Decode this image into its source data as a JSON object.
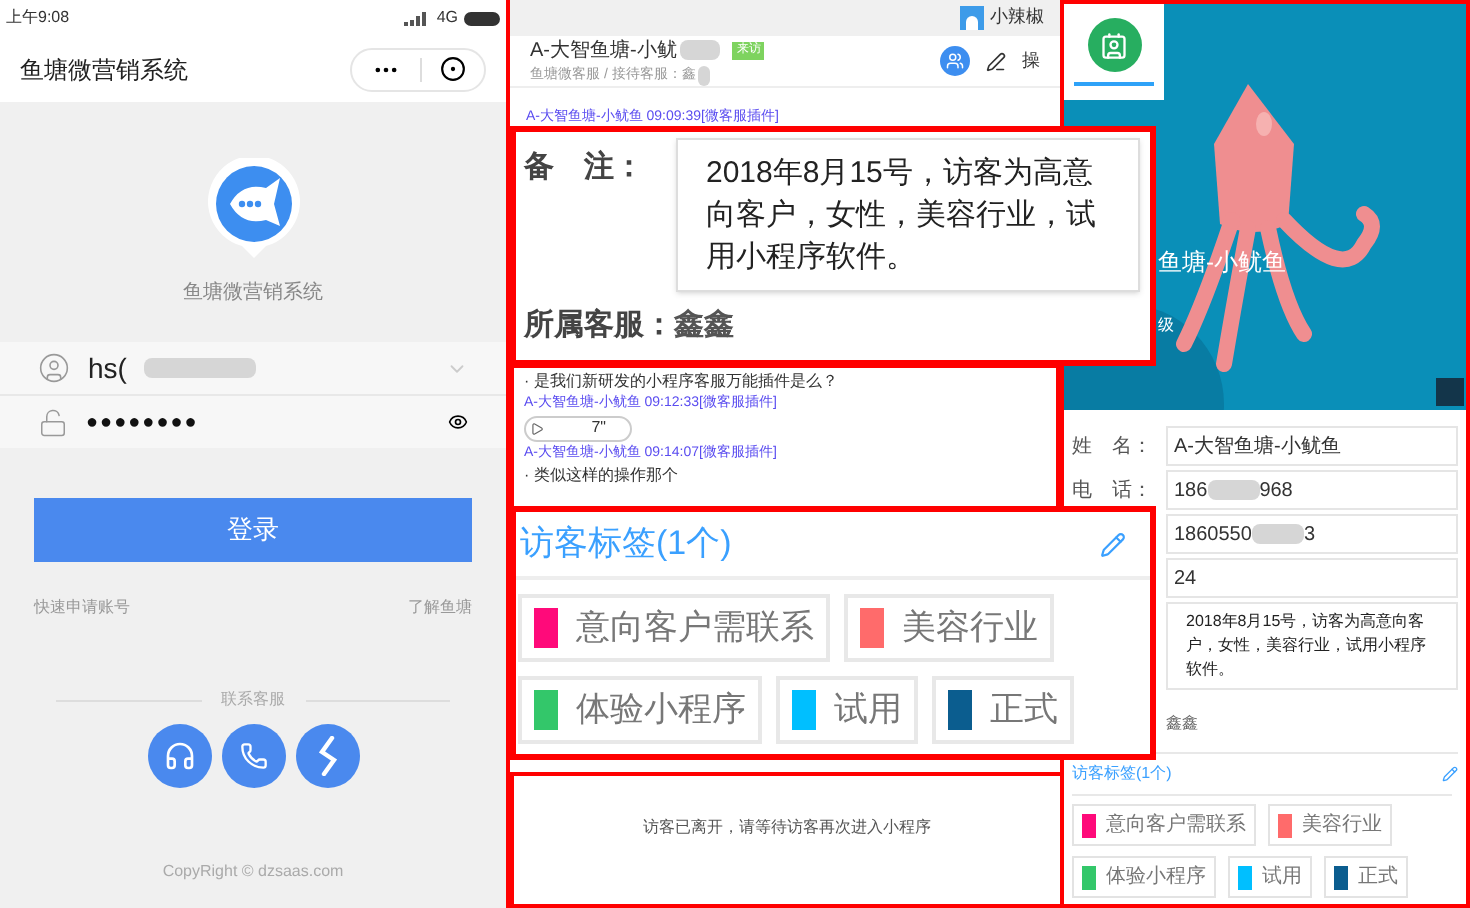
{
  "login_screen": {
    "status_bar": {
      "time": "上午9:08",
      "network": "4G"
    },
    "title": "鱼塘微营销系统",
    "app_name": "鱼塘微营销系统",
    "username": {
      "value": "hs("
    },
    "password": {
      "value": "●●●●●●●●"
    },
    "login_button": "登录",
    "links": [
      "快速申请账号",
      "了解鱼塘"
    ],
    "contact_label": "联系客服",
    "footer": "CopyRight © dzsaas.com"
  },
  "chat_panel": {
    "agent": "小辣椒",
    "visitor": {
      "name": "A-大智鱼塘-小鱿",
      "badge": "来访",
      "subtitle": "鱼塘微客服 / 接待客服：鑫"
    },
    "action_label": "操",
    "first_meta": "A-大智鱼塘-小鱿鱼 09:09:39[微客服插件]",
    "messages": [
      {
        "kind": "text",
        "text": "· 是我们新研发的小程序客服万能插件是么？"
      },
      {
        "kind": "meta",
        "text": "A-大智鱼塘-小鱿鱼 09:12:33[微客服插件]"
      },
      {
        "kind": "voice",
        "text": "7\""
      },
      {
        "kind": "meta",
        "text": "A-大智鱼塘-小鱿鱼 09:14:07[微客服插件]"
      },
      {
        "kind": "text",
        "text": "· 类似这样的操作那个"
      }
    ],
    "status_note": "访客已离开，请等待访客再次进入小程序"
  },
  "note_callout": {
    "label": "备　注：",
    "note": "2018年8月15号，访客为高意向客户，女性，美容行业，试用小程序软件。",
    "owner_label": "所属客服：",
    "owner": "鑫鑫"
  },
  "tags_callout": {
    "title": "访客标签(1个)",
    "tags": [
      {
        "label": "意向客户需联系",
        "color": "#ff0a7a"
      },
      {
        "label": "美容行业",
        "color": "#ff6b6b"
      },
      {
        "label": "体验小程序",
        "color": "#33c76a"
      },
      {
        "label": "试用",
        "color": "#00bfff"
      },
      {
        "label": "正式",
        "color": "#0b5d8f"
      }
    ]
  },
  "profile_panel": {
    "cover_name": "鱼塘-小鱿鱼",
    "cover_sub": "级",
    "fields": [
      {
        "label": "姓　名：",
        "value_parts": [
          "A-大智鱼塘-小鱿鱼"
        ]
      },
      {
        "label": "电　话：",
        "value_parts": [
          "186",
          "968"
        ]
      },
      {
        "value_parts": [
          "1860550",
          "3"
        ]
      },
      {
        "value_parts": [
          "24"
        ]
      }
    ],
    "note": "2018年8月15号，访客为高意向客户，女性，美容行业，试用小程序软件。",
    "owner": "鑫鑫",
    "tags_title": "访客标签(1个)",
    "tags": [
      {
        "label": "意向客户需联系",
        "color": "#ff0a7a"
      },
      {
        "label": "美容行业",
        "color": "#ff6b6b"
      },
      {
        "label": "体验小程序",
        "color": "#33c76a"
      },
      {
        "label": "试用",
        "color": "#00bfff"
      },
      {
        "label": "正式",
        "color": "#0b5d8f"
      }
    ]
  }
}
